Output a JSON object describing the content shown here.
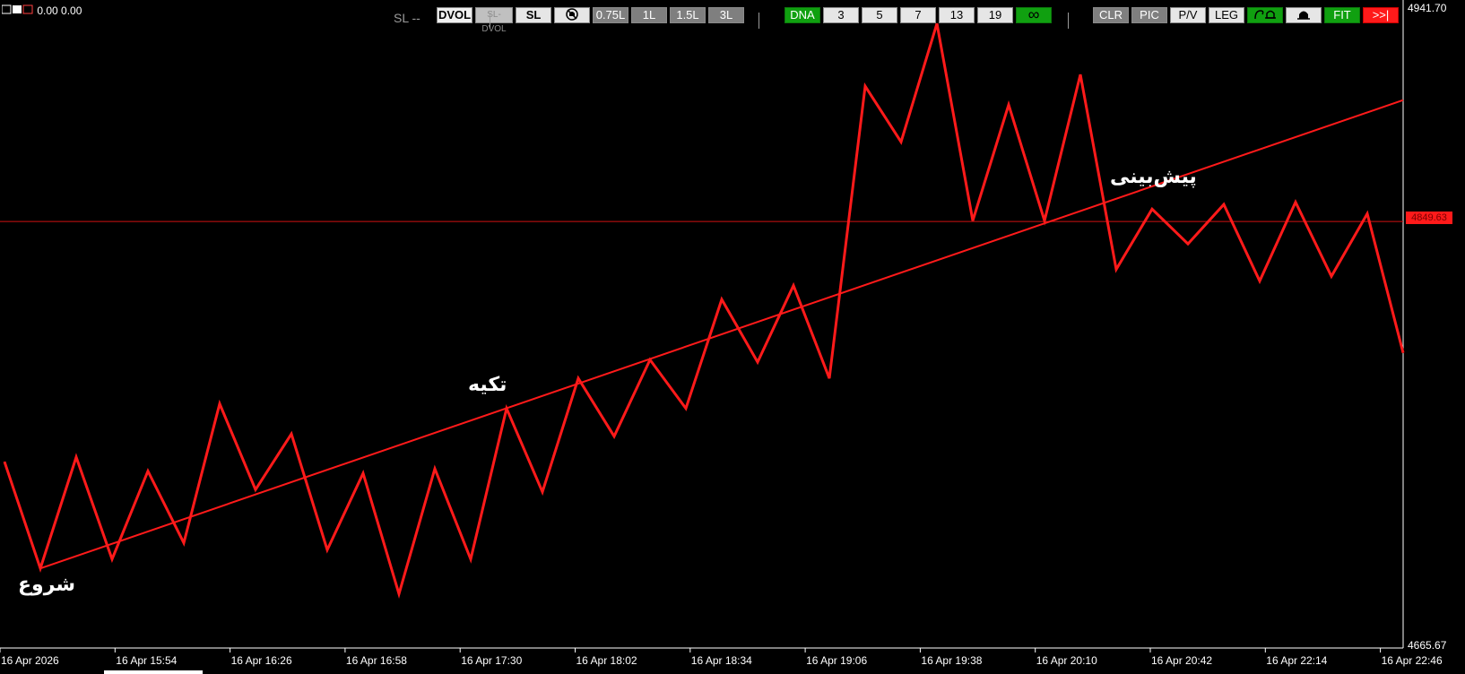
{
  "header": {
    "indicator_text": "0.00 0.00",
    "sl_label": "SL --"
  },
  "toolbar": {
    "dvol": "DVOL",
    "sl_dvol": "SL-DVOL",
    "sl": "SL",
    "l075": "0.75L",
    "l1": "1L",
    "l15": "1.5L",
    "l3": "3L",
    "dna": "DNA",
    "p3": "3",
    "p5": "5",
    "p7": "7",
    "p13": "13",
    "p19": "19",
    "infinity": "∞",
    "clr": "CLR",
    "pic": "PIC",
    "pv": "P/V",
    "leg": "LEG",
    "fit": "FIT",
    "scroll_end": ">>|"
  },
  "price_axis": {
    "top": "4941.70",
    "bottom": "4665.67",
    "current": "4849.63"
  },
  "time_axis": [
    "16 Apr 2026",
    "16 Apr 15:54",
    "16 Apr 16:26",
    "16 Apr 16:58",
    "16 Apr 17:30",
    "16 Apr 18:02",
    "16 Apr 18:34",
    "16 Apr 19:06",
    "16 Apr 19:38",
    "16 Apr 20:10",
    "16 Apr 20:42",
    "16 Apr 22:14",
    "16 Apr 22:46"
  ],
  "annotations": {
    "start": "شروع",
    "support": "تکیه",
    "forecast": "پیش‌بینی"
  },
  "colors": {
    "background": "#000000",
    "series": "#ff1a1a",
    "trendline": "#ff1a1a",
    "level_line": "#d01010"
  },
  "chart_data": {
    "type": "line",
    "title": "",
    "xlabel": "",
    "ylabel": "",
    "ylim": [
      4665.67,
      4941.7
    ],
    "horizontal_line": 4849.63,
    "series": [
      {
        "values": [
          4746,
          4700,
          4748,
          4704,
          4742,
          4711,
          4771,
          4734,
          4758,
          4708,
          4741,
          4689,
          4743,
          4704,
          4769,
          4733,
          4782,
          4757,
          4790,
          4769,
          4816,
          4789,
          4822,
          4782,
          4908,
          4884,
          4935,
          4850,
          4900,
          4850,
          4913,
          4829,
          4855,
          4840,
          4857,
          4824,
          4858,
          4826,
          4853,
          4793
        ]
      }
    ],
    "trendline": {
      "from": 4700,
      "to": 4902
    }
  }
}
